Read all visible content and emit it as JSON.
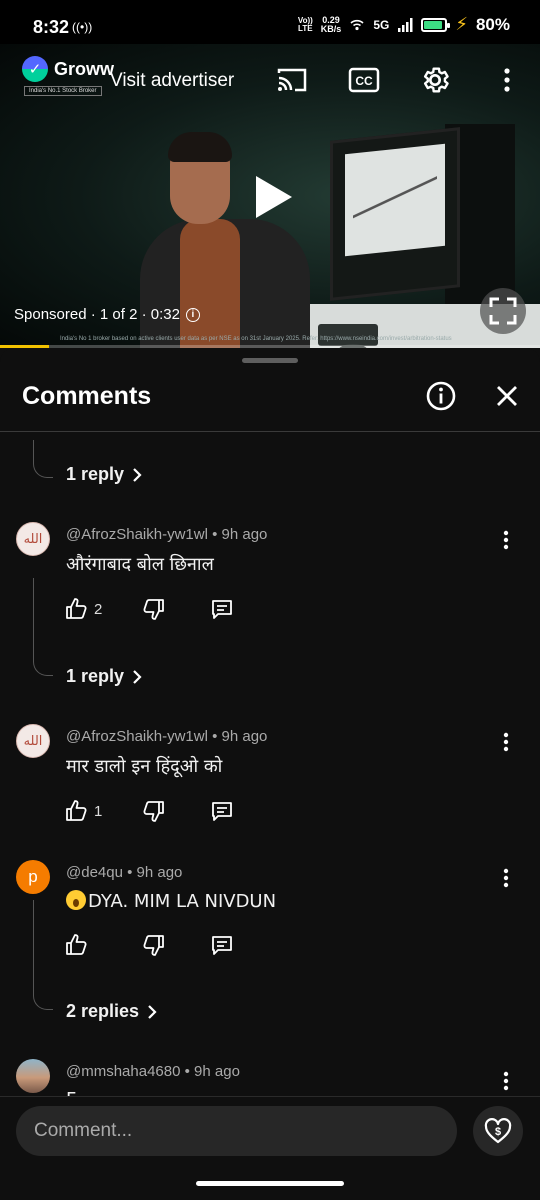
{
  "status_bar": {
    "time": "8:32",
    "hotspot": "((•))",
    "volte_top": "Vo))",
    "volte_bottom": "LTE",
    "speed_value": "0.29",
    "speed_unit": "KB/s",
    "network": "5G",
    "battery_percent": "80%",
    "battery_level": 0.8
  },
  "video": {
    "advertiser_logo_text": "Groww",
    "advertiser_tagline": "India's No.1 Stock Broker",
    "visit_advertiser": "Visit advertiser",
    "sponsored_label": "Sponsored · 1 of 2 · 0:32",
    "disclaimer": "India's No 1 broker based on active clients user data as per NSE as on 31st January 2025. Refer: https://www.nseindia.com/invest/arbitration-status",
    "progress": 0.09,
    "icons": [
      "cast-icon",
      "closed-captions-icon",
      "settings-gear-icon",
      "more-vertical-icon",
      "play-icon",
      "fullscreen-icon"
    ]
  },
  "comments_panel": {
    "title": "Comments",
    "top_reply_link": "1 reply",
    "items": [
      {
        "author": "@AfrozShaikh-yw1wl",
        "time": "9h ago",
        "meta": "@AfrozShaikh-yw1wl • 9h ago",
        "text": "औरंगाबाद बोल छिनाल",
        "likes": "2",
        "avatar_text": "الله",
        "replies_label": "1 reply"
      },
      {
        "author": "@AfrozShaikh-yw1wl",
        "time": "9h ago",
        "meta": "@AfrozShaikh-yw1wl • 9h ago",
        "text": "मार डालो इन हिंदूओ को",
        "likes": "1",
        "avatar_text": "الله"
      },
      {
        "author": "@de4qu",
        "time": "9h ago",
        "meta": "@de4qu • 9h ago",
        "text": "DYA. MIM LA NIVDUN",
        "likes": "",
        "avatar_letter": "p",
        "replies_label": "2 replies"
      },
      {
        "author": "@mmshaha4680",
        "time": "9h ago",
        "meta": "@mmshaha4680 • 9h ago",
        "text": "F"
      }
    ]
  },
  "composer": {
    "placeholder": "Comment..."
  },
  "colors": {
    "background": "#0f0f0f",
    "text": "#f1f1f1",
    "meta": "#aaaaaa",
    "progress": "#f2c200",
    "avatar_letter_bg": "#f57c00"
  }
}
